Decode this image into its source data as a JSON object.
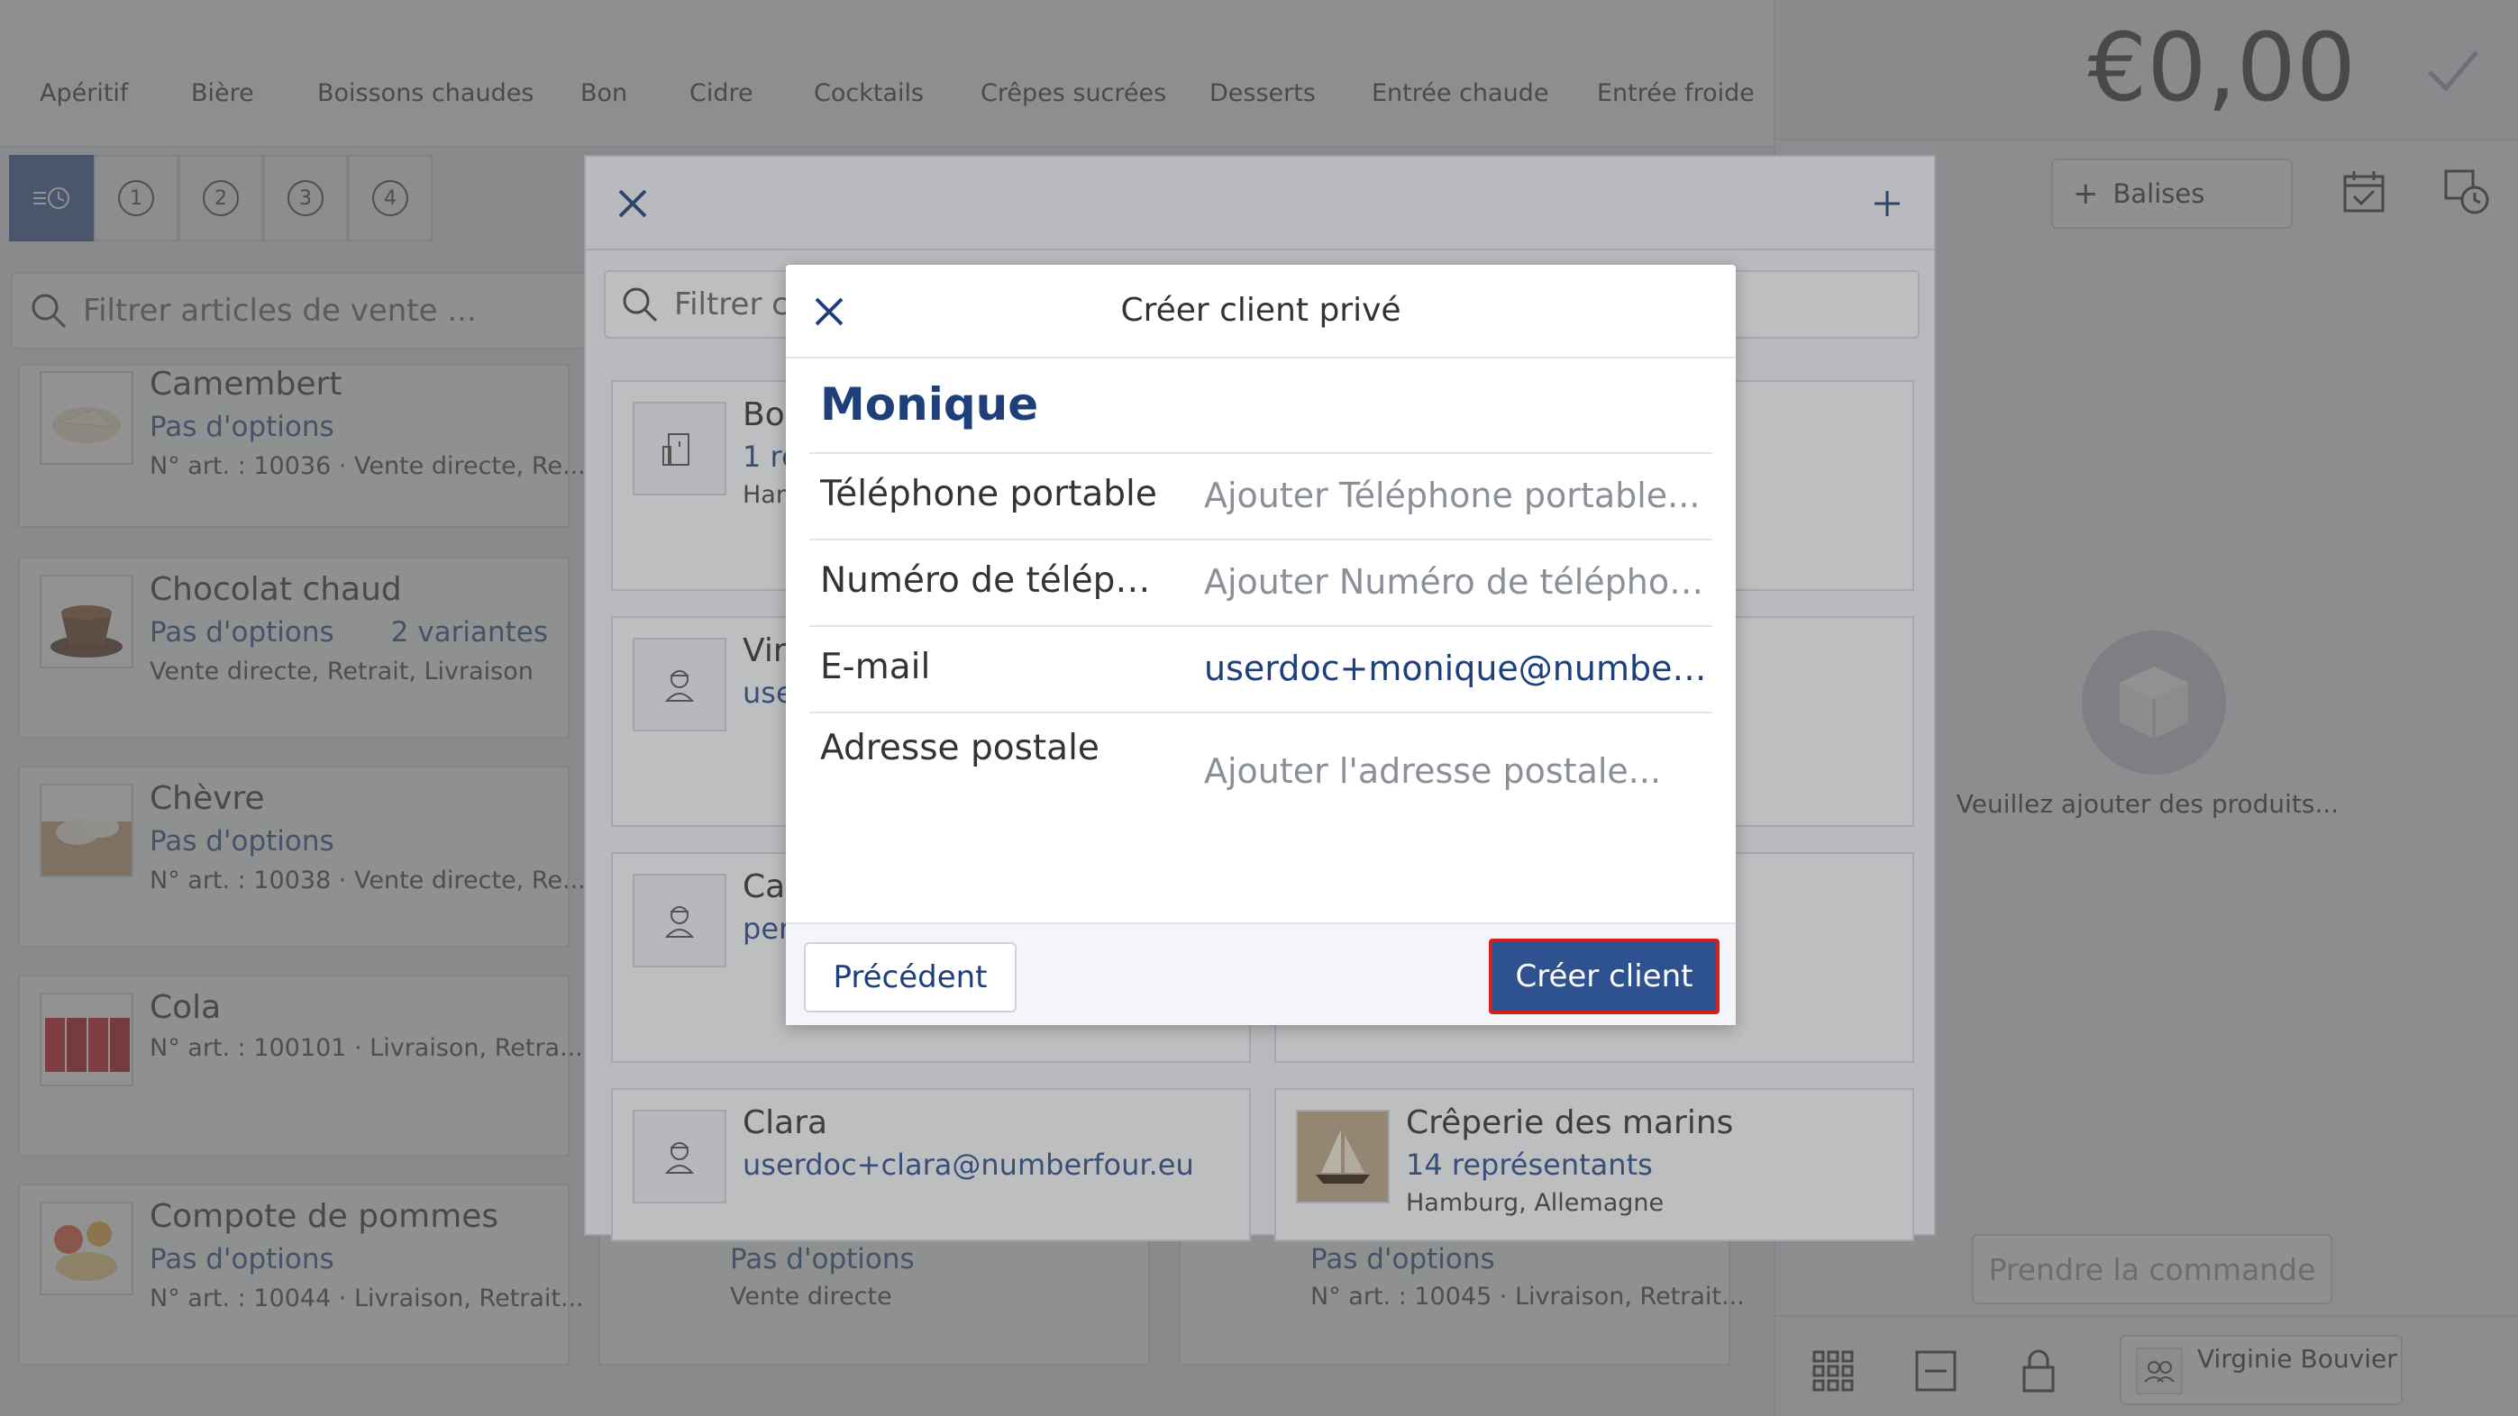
{
  "categories": [
    "Apéritif",
    "Bière",
    "Boissons chaudes",
    "Bon",
    "Cidre",
    "Cocktails",
    "Crêpes sucrées",
    "Desserts",
    "Entrée chaude",
    "Entrée froide"
  ],
  "order_tabs": [
    "1",
    "2",
    "3",
    "4"
  ],
  "left_search": {
    "placeholder": "Filtrer articles de vente ..."
  },
  "products": [
    {
      "name": "Camembert",
      "options": "Pas d'options",
      "meta": "N° art. : 10036 · Vente directe, Re..."
    },
    {
      "name": "Chocolat chaud",
      "options": "Pas d'options",
      "variants": "2 variantes",
      "meta": "Vente directe, Retrait, Livraison"
    },
    {
      "name": "Chèvre",
      "options": "Pas d'options",
      "meta": "N° art. : 10038 · Vente directe, Re..."
    },
    {
      "name": "Cola",
      "meta": "N° art. : 100101 · Livraison, Retra..."
    },
    {
      "name": "Compote de pommes",
      "options": "Pas d'options",
      "meta": "N° art. : 10044 · Livraison, Retrait..."
    }
  ],
  "mid_products": [
    {
      "options": "Pas d'options",
      "meta": "Vente directe"
    },
    {
      "options": "Pas d'options",
      "meta": "N° art. : 10045 · Livraison, Retrait..."
    }
  ],
  "right_panel": {
    "total": "€0,00",
    "tags_label": "Balises",
    "empty_text": "Veuillez ajouter des produits...",
    "order_button": "Prendre la commande",
    "user_name": "Virginie Bouvier"
  },
  "picker": {
    "search_placeholder": "Filtrer cl",
    "customers": [
      {
        "name": "Boi",
        "sub": "1 re",
        "meta": "Ham",
        "type": "company"
      },
      {
        "name": "Virg",
        "sub": "use",
        "type": "person"
      },
      {
        "name": "Can",
        "sub": "pers",
        "type": "person"
      },
      {
        "name": "Clara",
        "sub": "userdoc+clara@numberfour.eu",
        "type": "person"
      },
      {
        "name": "Crêperie des marins",
        "sub": "14 représentants",
        "meta": "Hamburg, Allemagne",
        "type": "image"
      }
    ]
  },
  "modal": {
    "title": "Créer client privé",
    "customer_name": "Monique",
    "fields": [
      {
        "label": "Téléphone portable",
        "value": "Ajouter Téléphone portable...",
        "filled": false
      },
      {
        "label": "Numéro de télépho...",
        "value": "Ajouter Numéro de téléphone f....",
        "filled": false
      },
      {
        "label": "E-mail",
        "value": "userdoc+monique@numberfo...",
        "filled": true
      },
      {
        "label": "Adresse postale",
        "value": "Ajouter l'adresse postale...",
        "filled": false
      }
    ],
    "back_button": "Précédent",
    "create_button": "Créer client"
  },
  "colors": {
    "accent": "#2e528f",
    "highlight_border": "#d42020",
    "link_blue": "#1e3f7a"
  }
}
